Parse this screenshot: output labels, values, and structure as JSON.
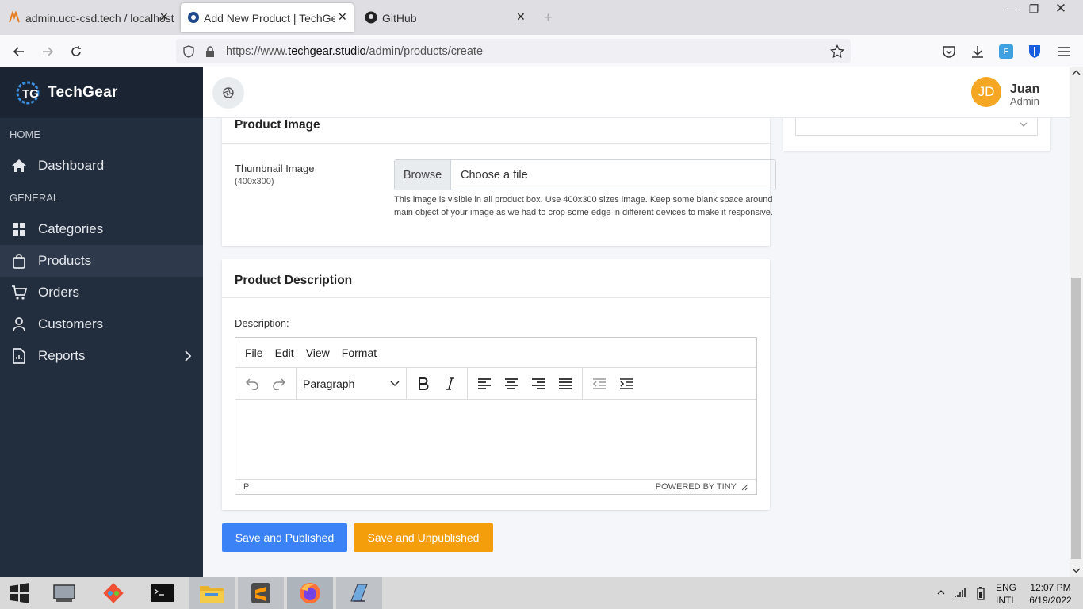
{
  "browser": {
    "tabs": [
      {
        "title": "admin.ucc-csd.tech / localhost"
      },
      {
        "title": "Add New Product | TechGear A"
      },
      {
        "title": "GitHub"
      }
    ],
    "url": {
      "prefix": "https://www.",
      "host": "techgear.studio",
      "path": "/admin/products/create"
    }
  },
  "app": {
    "brand": "TechGear",
    "user": {
      "initials": "JD",
      "name": "Juan",
      "role": "Admin"
    },
    "sidebar": {
      "home_label": "HOME",
      "general_label": "GENERAL",
      "items": [
        {
          "label": "Dashboard",
          "icon": "home-icon"
        },
        {
          "label": "Categories",
          "icon": "grid-icon"
        },
        {
          "label": "Products",
          "icon": "bag-icon"
        },
        {
          "label": "Orders",
          "icon": "cart-icon"
        },
        {
          "label": "Customers",
          "icon": "user-icon"
        },
        {
          "label": "Reports",
          "icon": "document-icon"
        }
      ]
    }
  },
  "image_card": {
    "title": "Product Image",
    "field_label": "Thumbnail Image",
    "field_sub": "(400x300)",
    "browse_label": "Browse",
    "file_placeholder": "Choose a file",
    "hint": "This image is visible in all product box. Use 400x300 sizes image. Keep some blank space around main object of your image as we had to crop some edge in different devices to make it responsive."
  },
  "description_card": {
    "title": "Product Description",
    "label": "Description:",
    "menu": [
      "File",
      "Edit",
      "View",
      "Format"
    ],
    "format_select": "Paragraph",
    "status_path": "P",
    "powered_by": "POWERED BY TINY"
  },
  "actions": {
    "publish_label": "Save and Published",
    "unpublish_label": "Save and Unpublished",
    "publish_color": "#3b82f6",
    "unpublish_color": "#f59e0b"
  },
  "taskbar": {
    "lang1": "ENG",
    "lang2": "INTL",
    "time": "12:07 PM",
    "date": "6/19/2022"
  }
}
